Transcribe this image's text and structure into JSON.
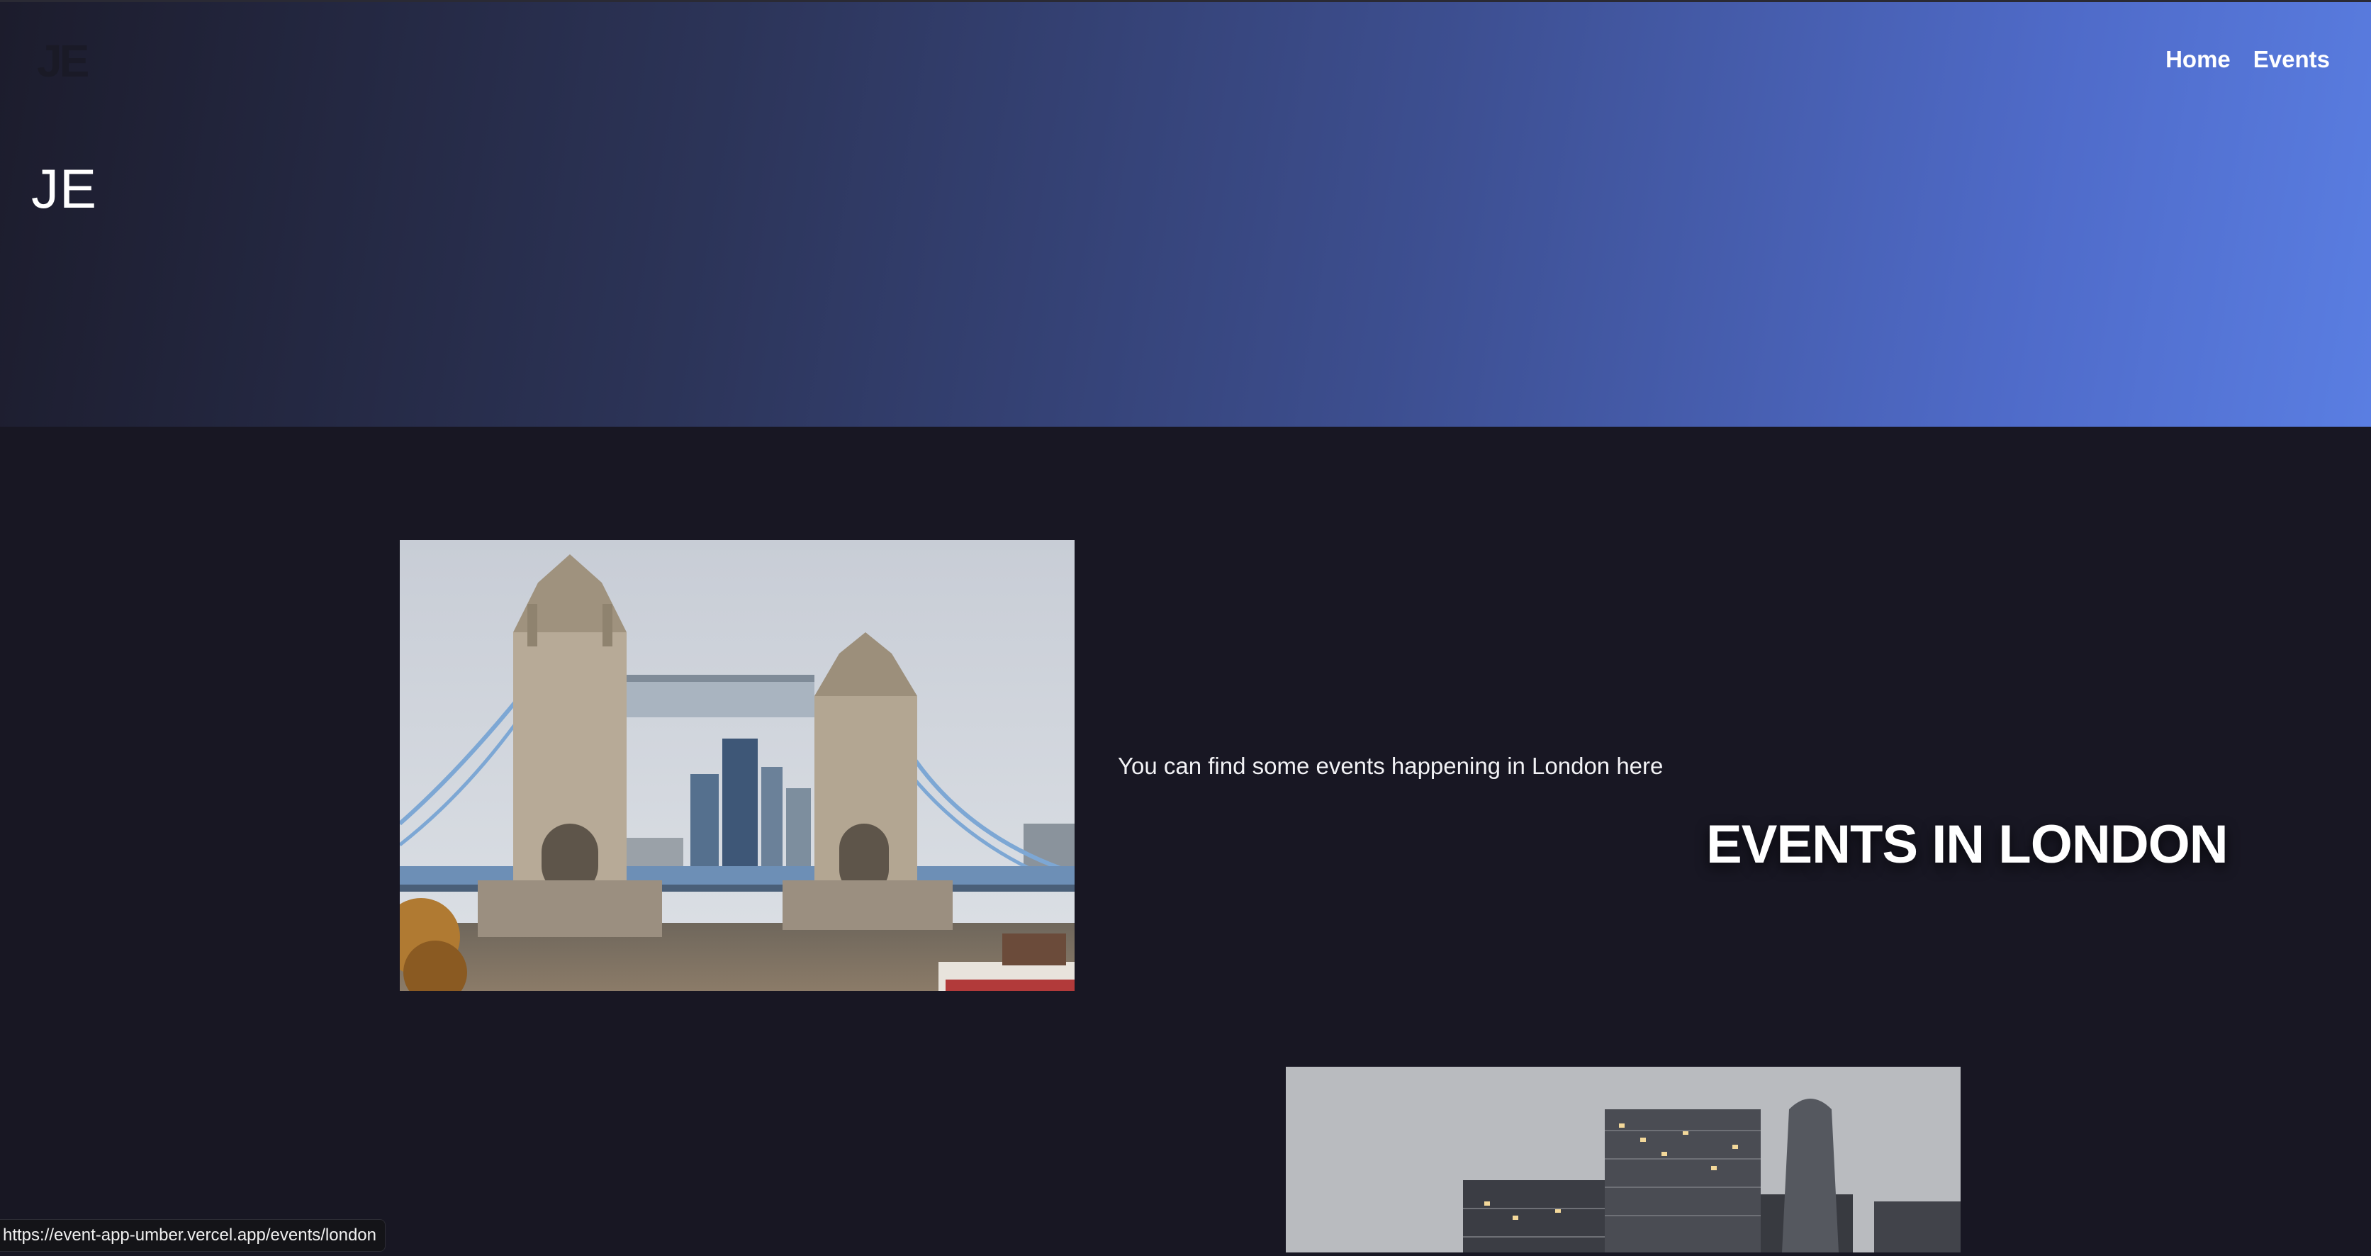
{
  "header": {
    "brand": "JE",
    "nav": [
      {
        "label": "Home"
      },
      {
        "label": "Events"
      }
    ]
  },
  "main": {
    "event": {
      "image_subject": "tower-bridge-photo",
      "description": "You can find some events happening in London here",
      "title": "EVENTS IN LONDON"
    },
    "next_event": {
      "image_subject": "city-skyline-photo"
    }
  },
  "status_bar": {
    "url": "https://event-app-umber.vercel.app/events/london"
  },
  "colors": {
    "background": "#181723",
    "hero_gradient_start": "#1c1c2c",
    "hero_gradient_end": "#5a7ee2",
    "text": "#ffffff"
  }
}
